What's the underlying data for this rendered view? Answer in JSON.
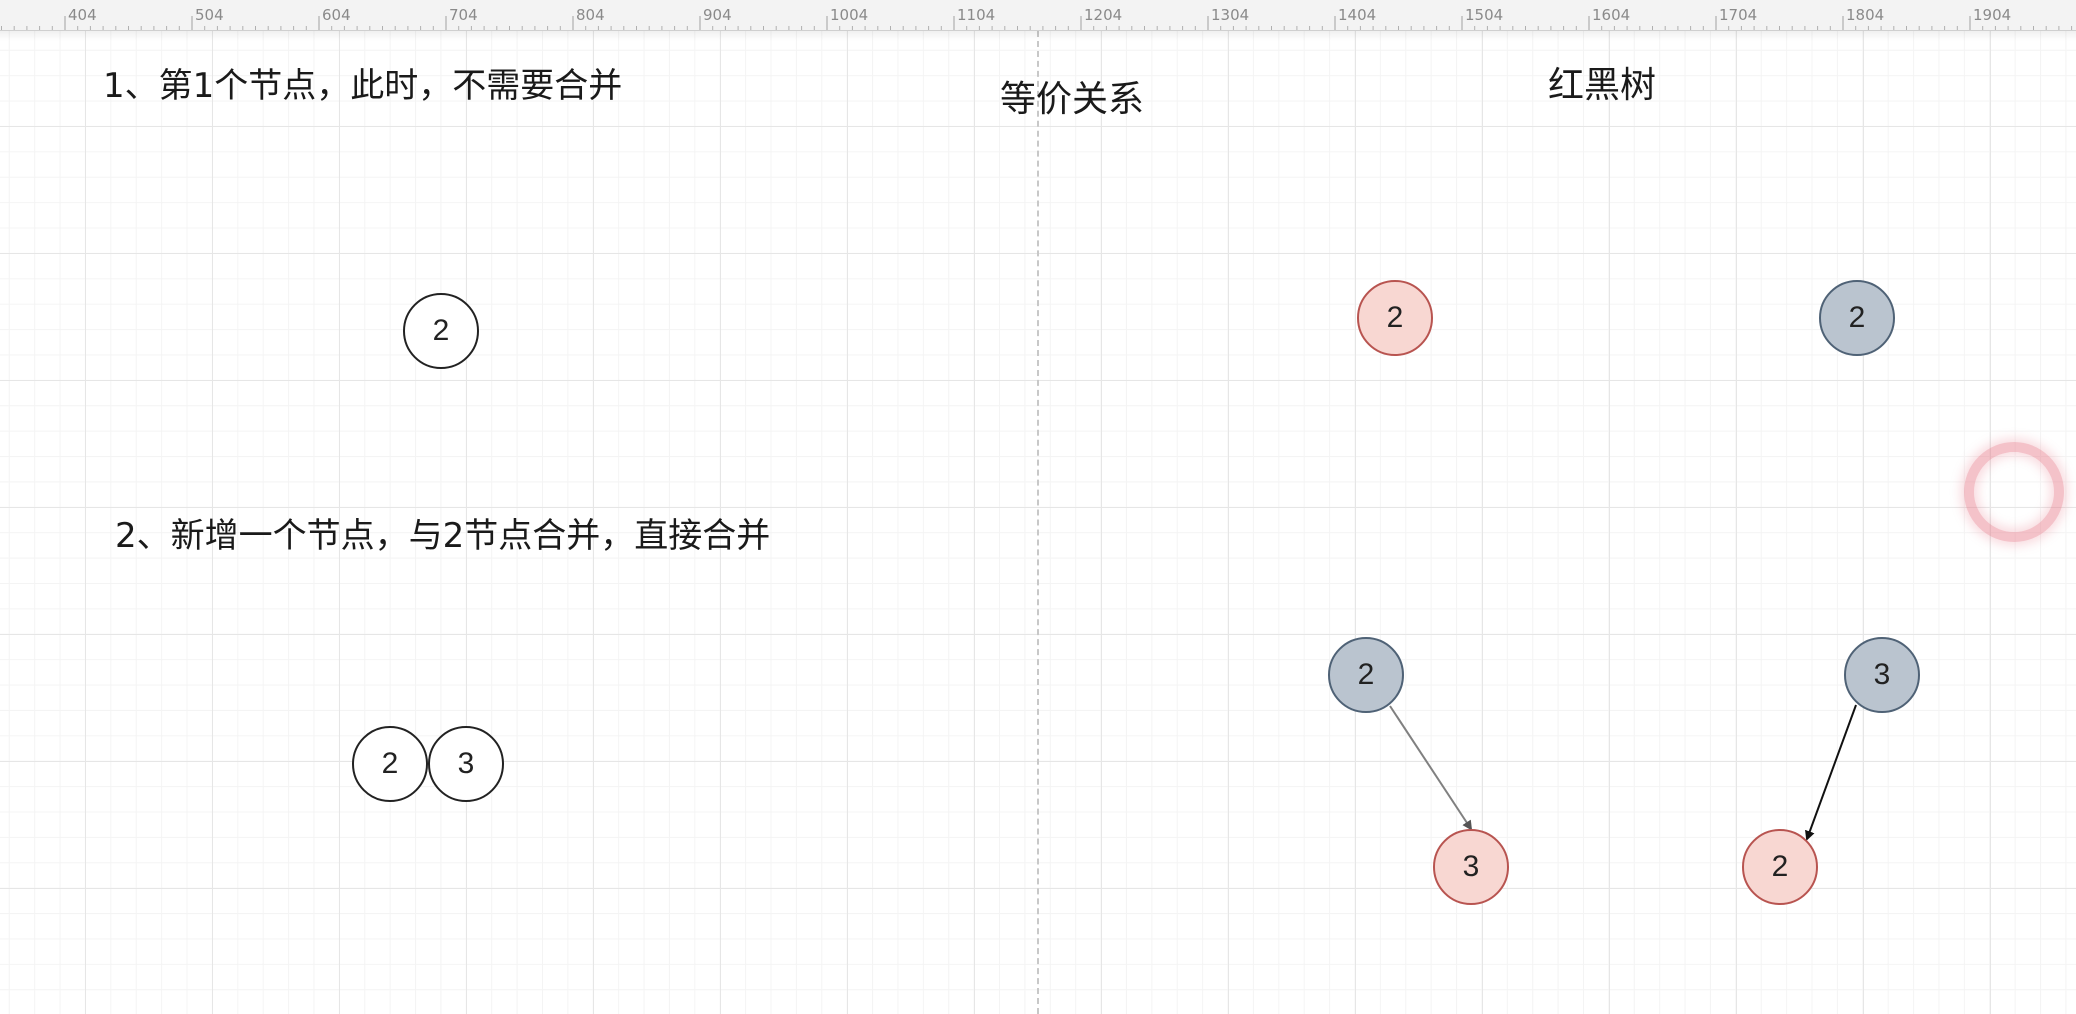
{
  "ruler": {
    "ticks": [
      "404",
      "504",
      "604",
      "704",
      "804",
      "904",
      "1004",
      "1104",
      "1204",
      "1304",
      "1404",
      "1504",
      "1604",
      "1704",
      "1804",
      "1904"
    ]
  },
  "captions": {
    "step1": "1、第1个节点，此时，不需要合并",
    "step2": "2、新增一个节点，与2节点合并，直接合并",
    "equivalence": "等价关系",
    "red_black_tree": "红黑树"
  },
  "two_three_tree": {
    "step1_node": {
      "keys": [
        "2"
      ]
    },
    "step2_node": {
      "keys": [
        "2",
        "3"
      ]
    }
  },
  "red_black_tree": {
    "step1_a": {
      "key": "2",
      "color": "red"
    },
    "step1_b": {
      "key": "2",
      "color": "black"
    },
    "step2_a": {
      "root": {
        "key": "2",
        "color": "black"
      },
      "child": {
        "key": "3",
        "color": "red",
        "side": "right"
      }
    },
    "step2_b": {
      "root": {
        "key": "3",
        "color": "black"
      },
      "child": {
        "key": "2",
        "color": "red",
        "side": "left"
      }
    }
  },
  "colors": {
    "red_node_fill": "#f8d7d2",
    "red_node_stroke": "#b85450",
    "black_node_fill": "#bac4cf",
    "black_node_stroke": "#4f6276",
    "plain_node_stroke": "#222222",
    "edge_a": "#808080",
    "edge_b": "#111111"
  }
}
